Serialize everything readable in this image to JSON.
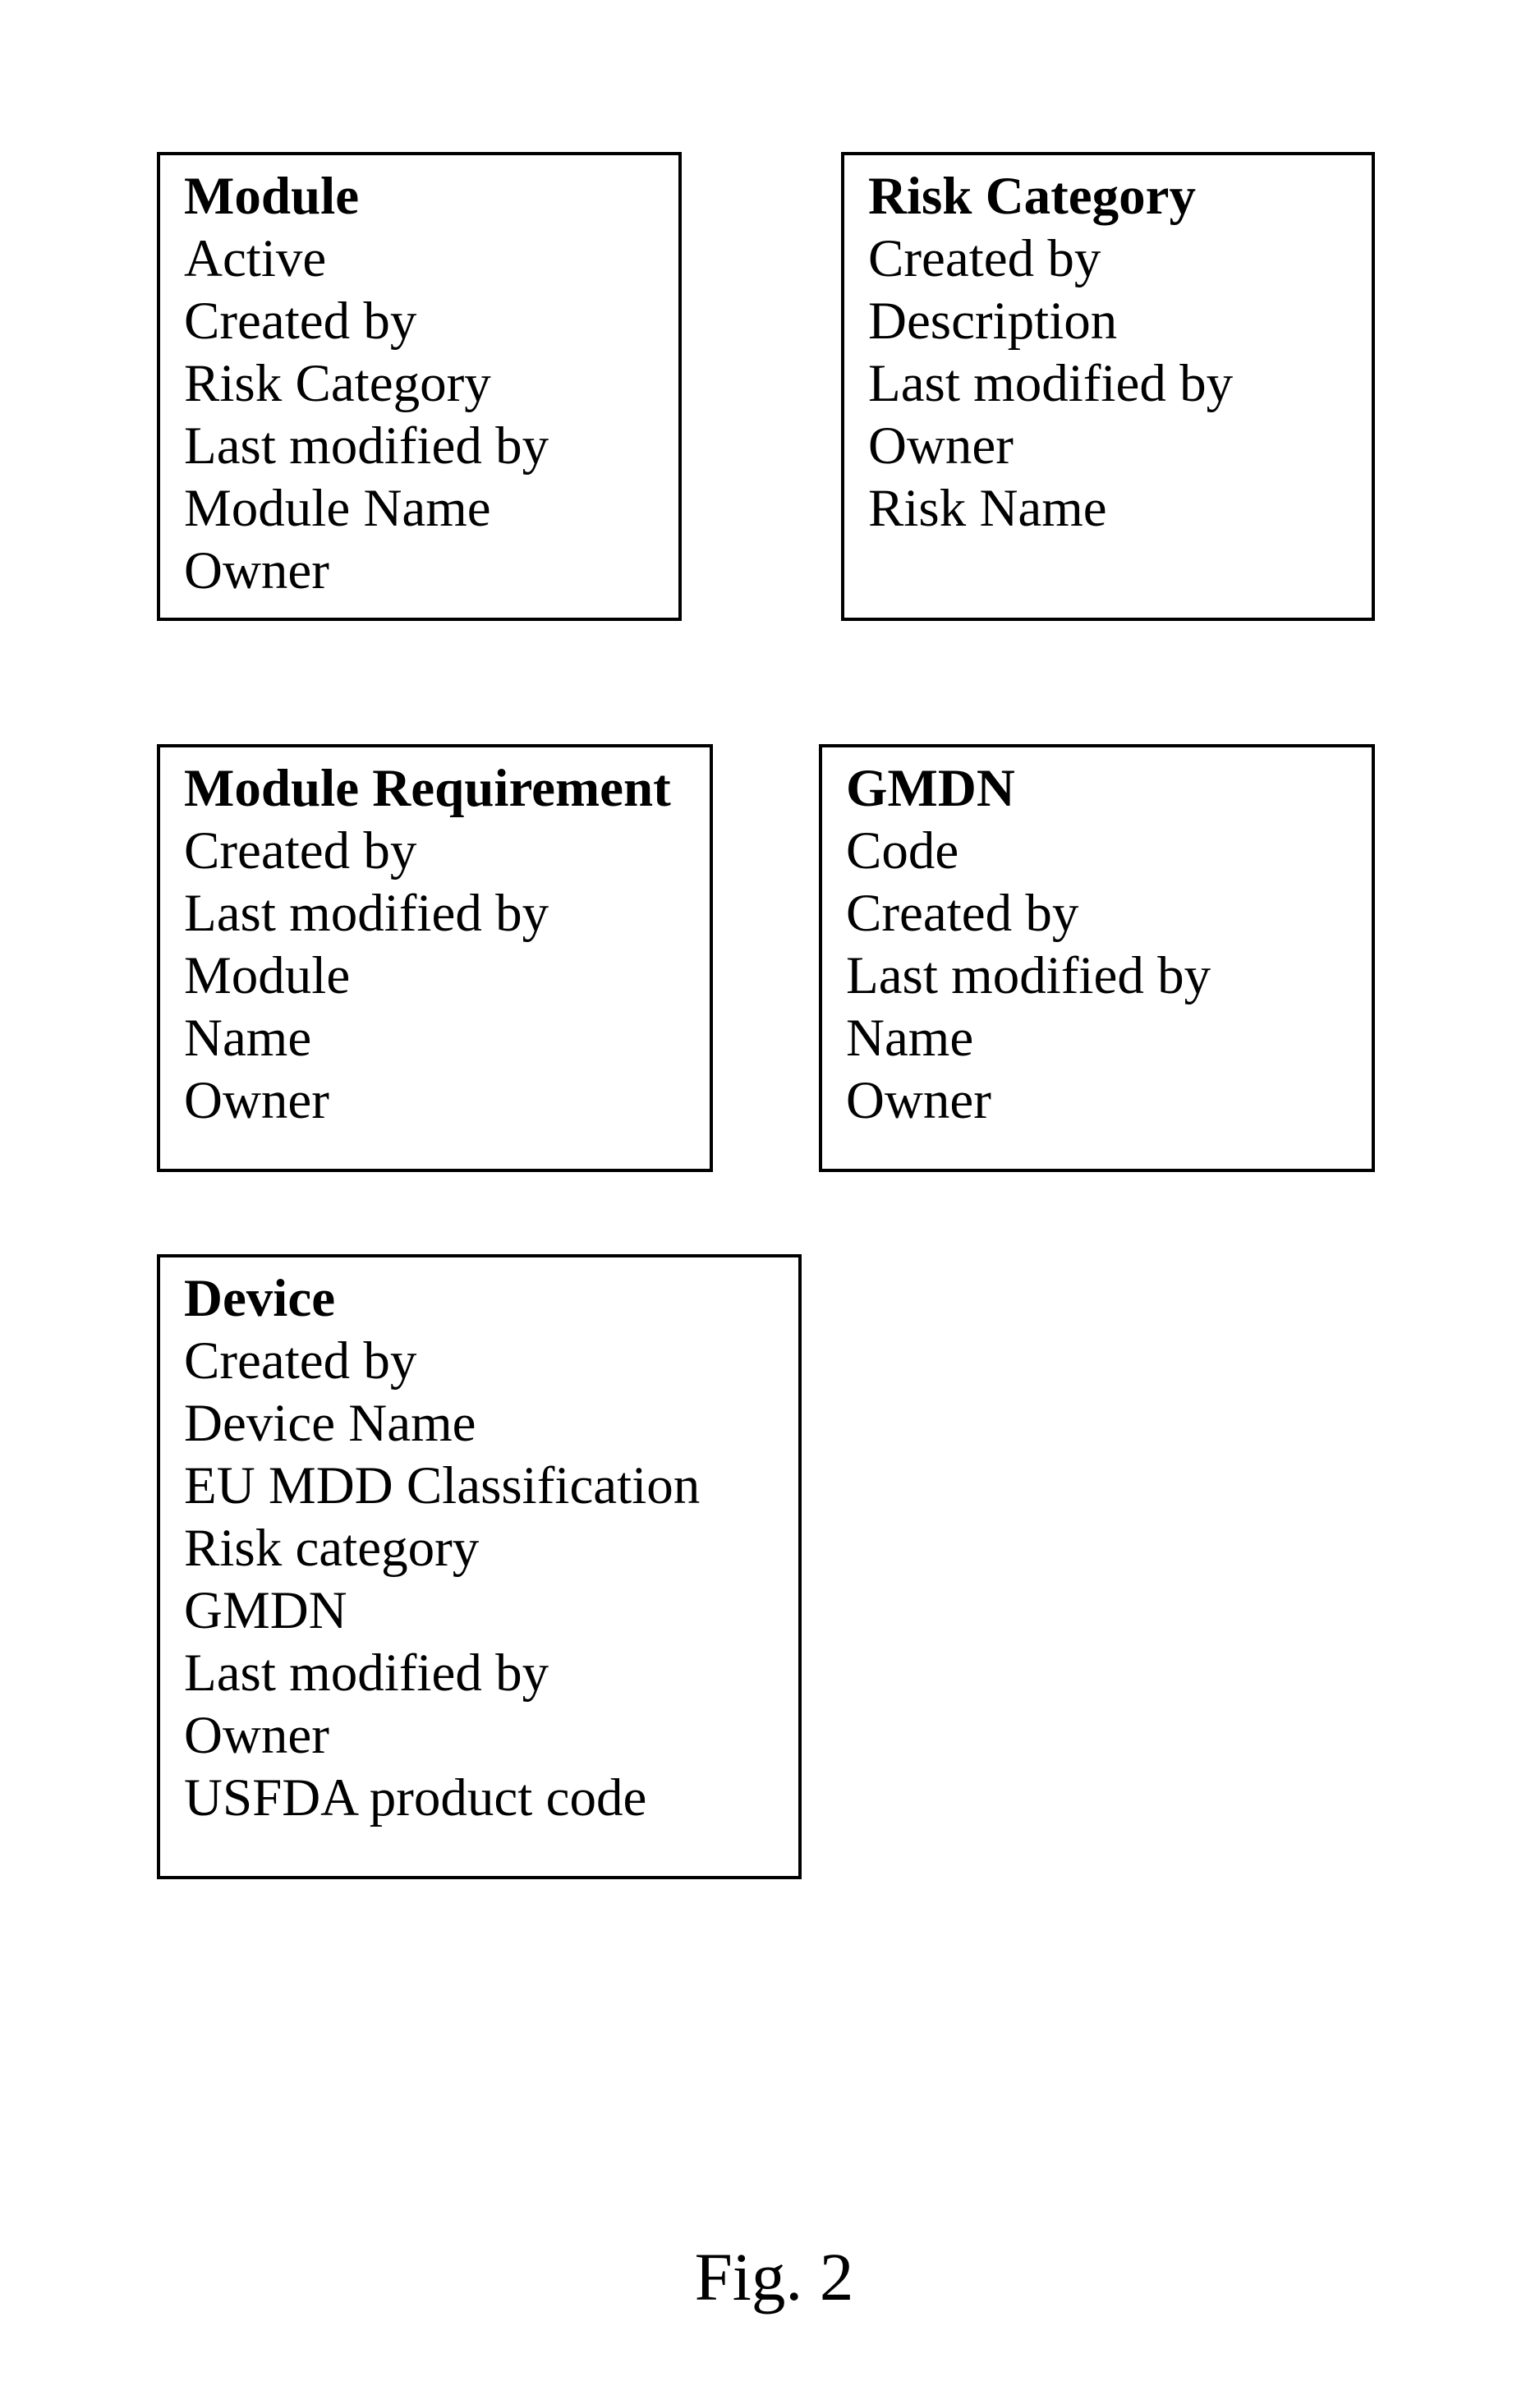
{
  "figure": {
    "label": "Fig. 2"
  },
  "entities": {
    "module": {
      "title": "Module",
      "fields": [
        "Active",
        "Created by",
        "Risk Category",
        "Last modified by",
        "Module Name",
        "Owner"
      ]
    },
    "risk_category": {
      "title": "Risk Category",
      "fields": [
        "Created by",
        "Description",
        "Last modified by",
        "Owner",
        "Risk Name"
      ]
    },
    "module_requirement": {
      "title": "Module Requirement",
      "fields": [
        "Created by",
        "Last modified by",
        "Module",
        "Name",
        "Owner"
      ]
    },
    "gmdn": {
      "title": "GMDN",
      "fields": [
        "Code",
        "Created by",
        "Last modified by",
        "Name",
        "Owner"
      ]
    },
    "device": {
      "title": "Device",
      "fields": [
        "Created by",
        "Device Name",
        "EU MDD Classification",
        "Risk category",
        "GMDN",
        "Last modified by",
        "Owner",
        "USFDA product code"
      ]
    }
  }
}
